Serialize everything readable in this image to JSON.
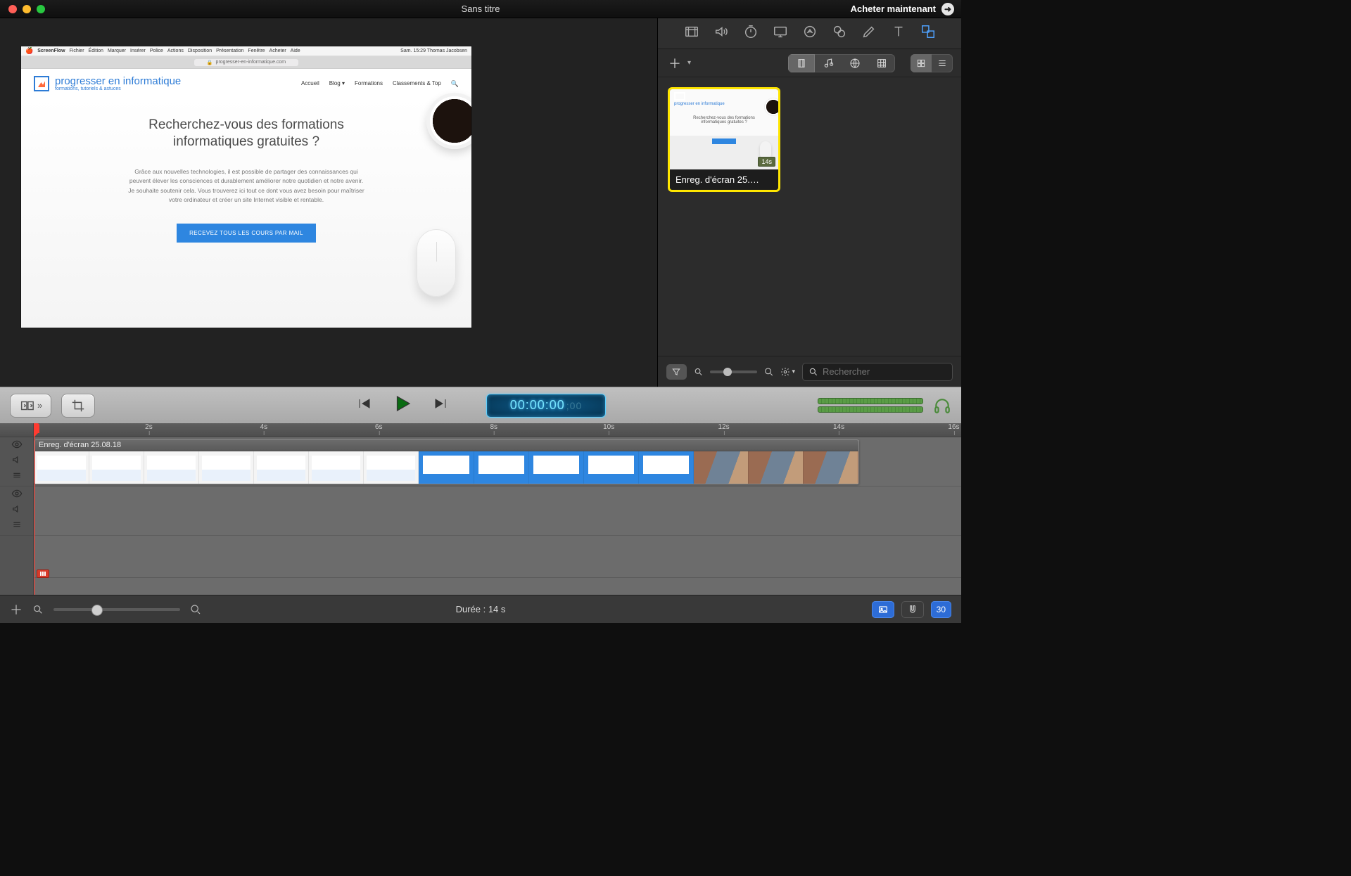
{
  "window": {
    "title": "Sans titre",
    "buy_now": "Acheter maintenant"
  },
  "preview": {
    "menubar": {
      "app": "ScreenFlow",
      "items": [
        "Fichier",
        "Édition",
        "Marquer",
        "Insérer",
        "Police",
        "Actions",
        "Disposition",
        "Présentation",
        "Fenêtre",
        "Acheter",
        "Aide"
      ],
      "right": "Sam. 15:29   Thomas Jacobsen"
    },
    "url": "progresser-en-informatique.com",
    "logo_title": "progresser en informatique",
    "logo_sub": "formations, tutoriels & astuces",
    "nav": [
      "Accueil",
      "Blog ▾",
      "Formations",
      "Classements & Top"
    ],
    "h1_line1": "Recherchez-vous des formations",
    "h1_line2": "informatiques gratuites ?",
    "para": "Grâce aux nouvelles technologies, il est possible de partager des connaissances qui peuvent élever les consciences et durablement améliorer notre quotidien et notre avenir. Je souhaite soutenir cela. Vous trouverez ici tout ce dont vous avez besoin pour maîtriser votre ordinateur et créer un site Internet visible et rentable.",
    "cta": "RECEVEZ TOUS LES COURS PAR MAIL"
  },
  "side": {
    "tool_icons": [
      "video",
      "audio",
      "timer",
      "screen",
      "pointer",
      "link",
      "pen",
      "text",
      "multiframe"
    ],
    "media_tabs": [
      "local",
      "music",
      "globe",
      "grid"
    ],
    "view_modes": [
      "grid",
      "list"
    ],
    "media_item_label": "Enreg. d'écran 25.…",
    "media_duration_badge": "14s",
    "search_placeholder": "Rechercher"
  },
  "playbar": {
    "timecode_main": "00:00:00",
    "timecode_sub": ";00"
  },
  "timeline": {
    "ticks": [
      {
        "label": "2s",
        "pct": 12.4
      },
      {
        "label": "4s",
        "pct": 24.8
      },
      {
        "label": "6s",
        "pct": 37.2
      },
      {
        "label": "8s",
        "pct": 49.6
      },
      {
        "label": "10s",
        "pct": 62.0
      },
      {
        "label": "12s",
        "pct": 74.4
      },
      {
        "label": "14s",
        "pct": 86.8
      },
      {
        "label": "16s",
        "pct": 99.2
      }
    ],
    "clip_title": "Enreg. d'écran 25.08.18",
    "clip_width_pct": 89.0
  },
  "footer": {
    "duration_label": "Durée : 14 s",
    "fps": "30"
  }
}
